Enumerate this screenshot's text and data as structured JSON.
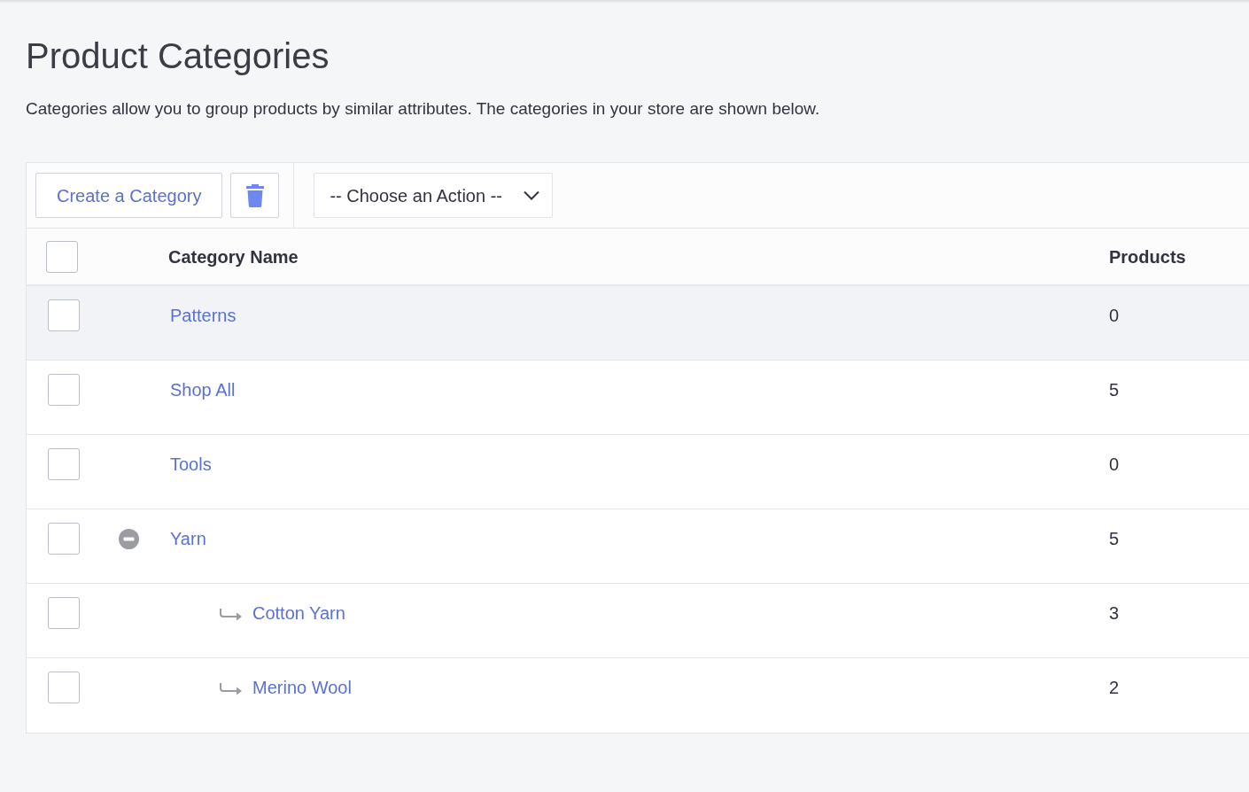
{
  "page": {
    "title": "Product Categories",
    "description": "Categories allow you to group products by similar attributes. The categories in your store are shown below."
  },
  "toolbar": {
    "create_button": "Create a Category",
    "action_select": {
      "value": "-- Choose an Action --"
    }
  },
  "table": {
    "select_all": {
      "checked": false
    },
    "columns": [
      "Category Name",
      "Products"
    ],
    "rows": [
      {
        "name": "Patterns",
        "products": "0",
        "checked": false,
        "highlighted": true
      },
      {
        "name": "Shop All",
        "products": "5",
        "checked": false,
        "highlighted": false
      },
      {
        "name": "Tools",
        "products": "0",
        "checked": false,
        "highlighted": false
      },
      {
        "name": "Yarn",
        "products": "5",
        "checked": false,
        "highlighted": false,
        "expanded": true,
        "children": [
          {
            "name": "Cotton Yarn",
            "products": "3",
            "checked": false,
            "highlighted": false
          },
          {
            "name": "Merino Wool",
            "products": "2",
            "checked": false,
            "highlighted": false
          }
        ]
      }
    ]
  }
}
